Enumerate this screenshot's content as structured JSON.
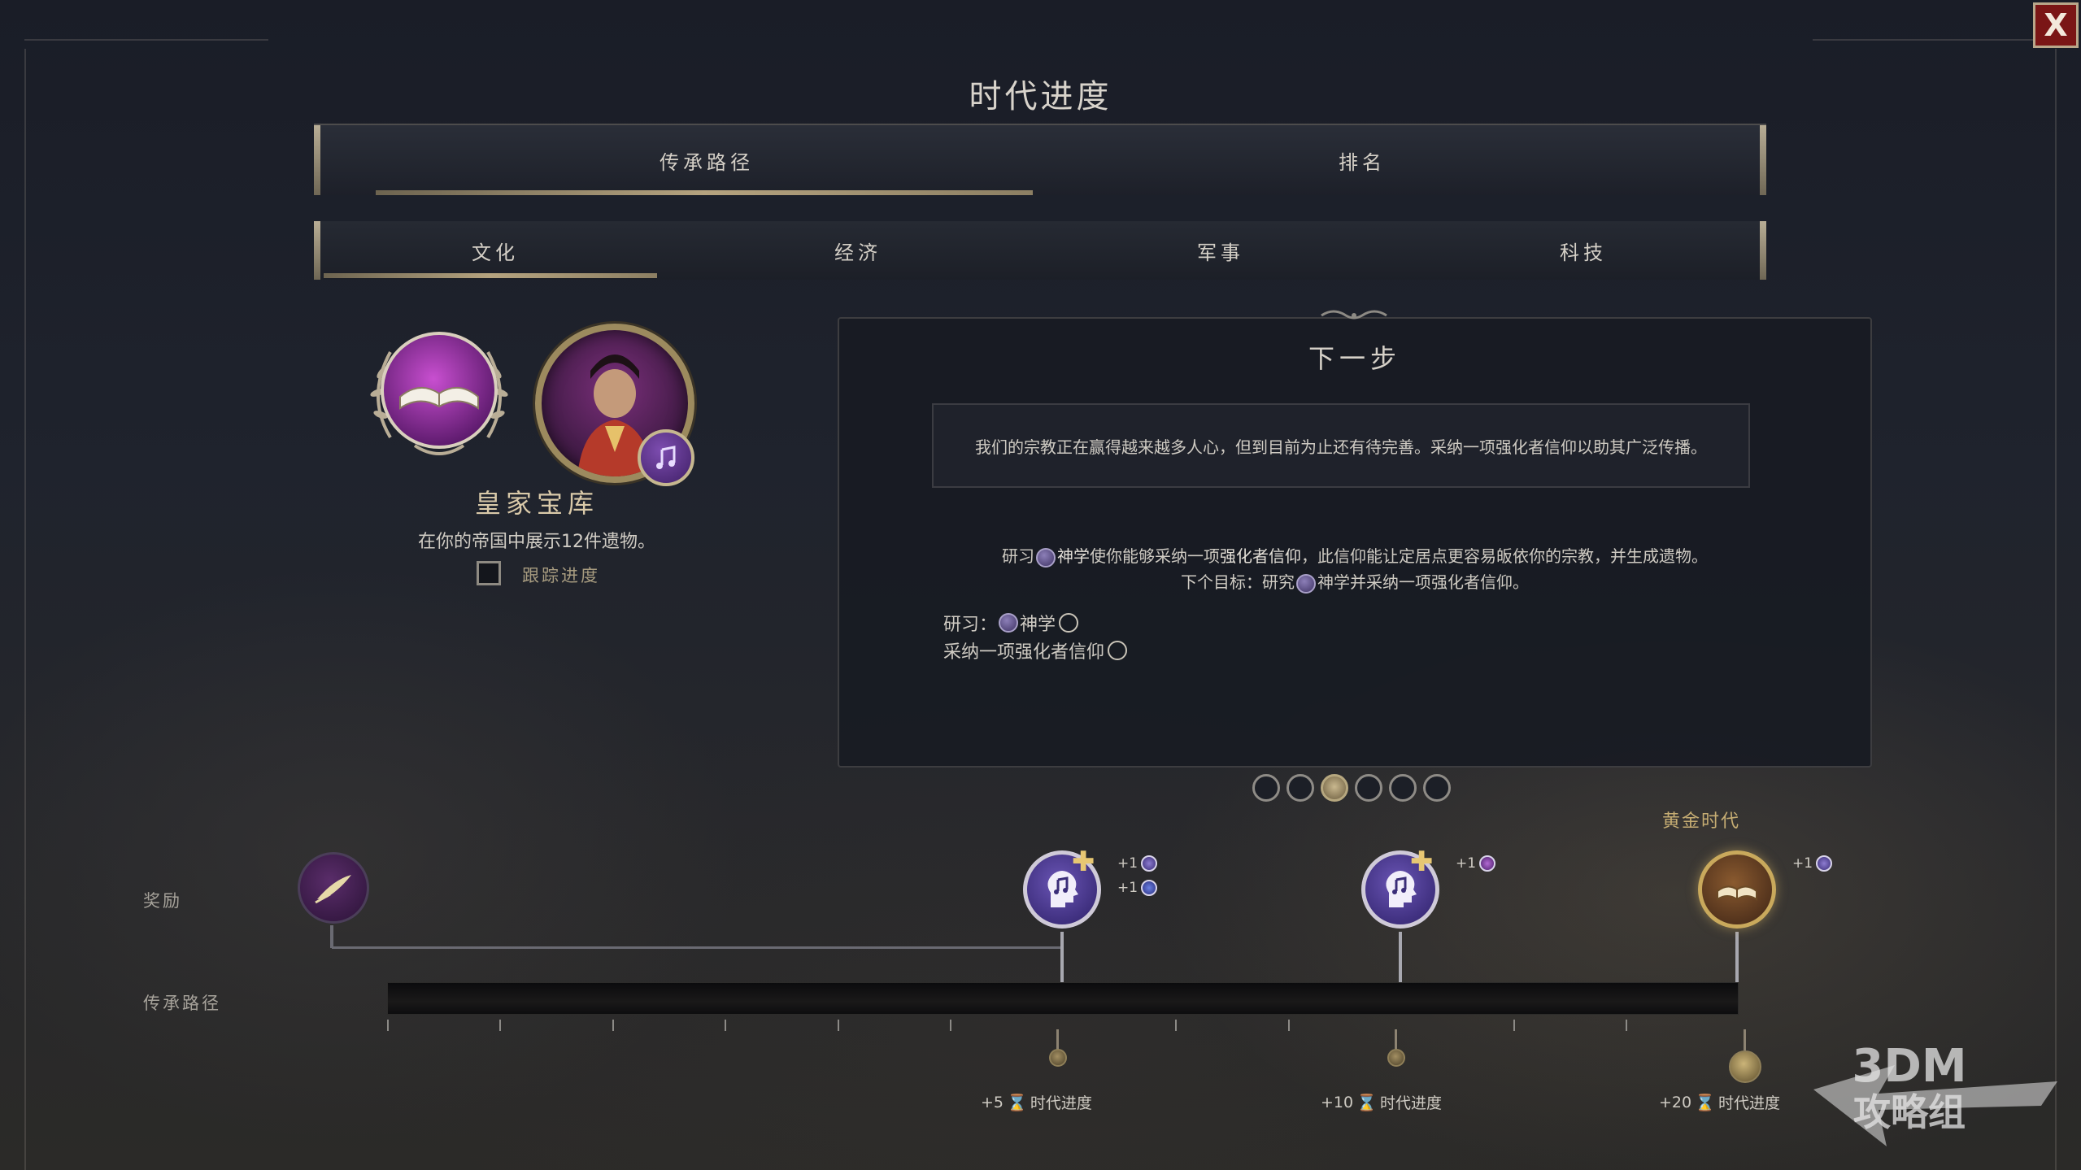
{
  "window": {
    "title": "时代进度",
    "close_label": "X"
  },
  "tabs_primary": [
    {
      "label": "传承路径",
      "active": true
    },
    {
      "label": "排名",
      "active": false
    }
  ],
  "tabs_secondary": [
    {
      "label": "文化",
      "active": true
    },
    {
      "label": "经济",
      "active": false
    },
    {
      "label": "军事",
      "active": false
    },
    {
      "label": "科技",
      "active": false
    }
  ],
  "wonder": {
    "name": "皇家宝库",
    "description": "在你的帝国中展示12件遗物。",
    "track_label": "跟踪进度",
    "track_checked": false,
    "icons": [
      "book-laurel-icon",
      "leader-portrait",
      "music-note-icon"
    ]
  },
  "next_step": {
    "title": "下一步",
    "description": "我们的宗教正在赢得越来越多人心，但到目前为止还有待完善。采纳一项强化者信仰以助其广泛传播。",
    "info_line_1": {
      "pre": "研习",
      "tech": "神学",
      "mid": "使你能够采纳一项",
      "bold": "强化者信仰",
      "post": "，此信仰能让定居点更容易皈依你的宗教，并生成遗物。"
    },
    "info_line_2": {
      "pre": "下个目标：研究",
      "tech": "神学",
      "post": "并采纳一项强化者信仰。"
    },
    "objectives": [
      {
        "prefix": "研习：",
        "label": "神学",
        "done": false
      },
      {
        "prefix": "",
        "label": "采纳一项强化者信仰",
        "done": false
      }
    ],
    "page_count": 6,
    "page_active": 3
  },
  "rewards_row": {
    "label_rewards": "奖励",
    "label_legacy": "传承路径",
    "golden_age_label": "黄金时代",
    "nodes": [
      {
        "icon": "quill-icon",
        "bonuses": []
      },
      {
        "icon": "music-head-plus-icon",
        "bonuses": [
          {
            "text": "+1",
            "icon": "great-work-icon"
          },
          {
            "text": "+1",
            "icon": "relic-icon"
          }
        ]
      },
      {
        "icon": "music-head-plus-icon",
        "bonuses": [
          {
            "text": "+1",
            "icon": "theology-icon"
          }
        ]
      },
      {
        "icon": "golden-book-icon",
        "bonuses": [
          {
            "text": "+1",
            "icon": "great-work-icon"
          }
        ]
      }
    ],
    "milestones": [
      {
        "amount": "+5",
        "label": "时代进度"
      },
      {
        "amount": "+10",
        "label": "时代进度"
      },
      {
        "amount": "+20",
        "label": "时代进度"
      }
    ],
    "progress_fraction": 0.0
  },
  "watermark": {
    "text_line1": "3DM",
    "text_line2": "攻略组"
  },
  "colors": {
    "accent_gold": "#c6ad73",
    "close_red": "#7a1616",
    "panel_bg": "#181b23"
  }
}
